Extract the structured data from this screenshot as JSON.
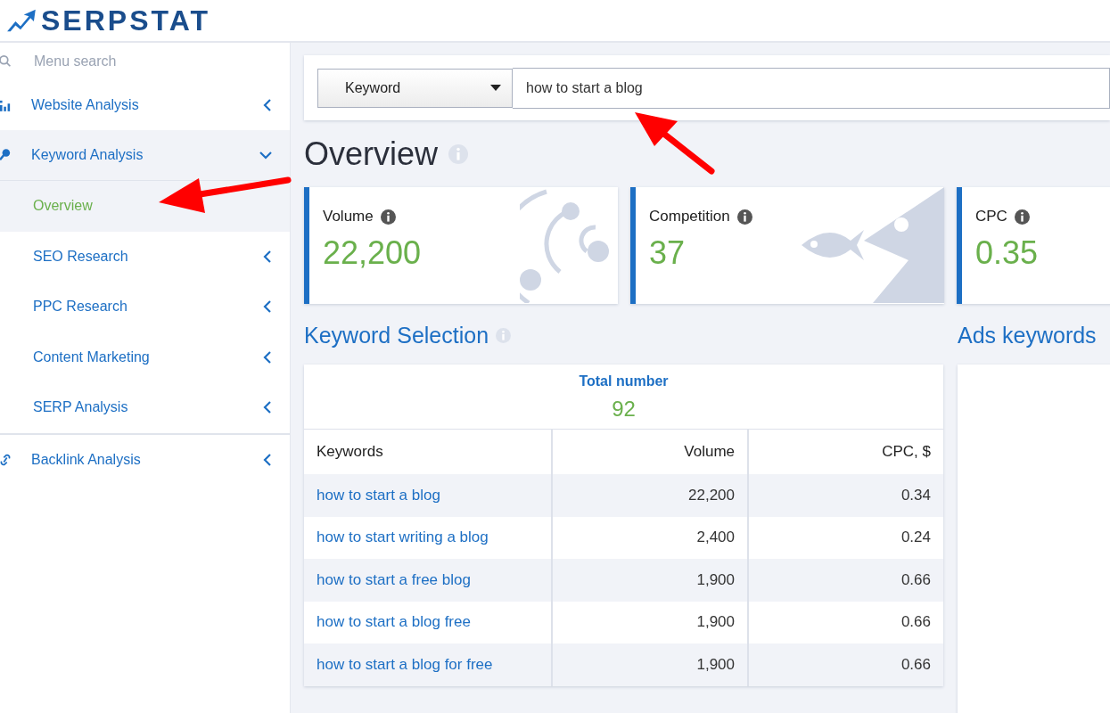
{
  "logo": {
    "text": "SERPSTAT"
  },
  "sidebar": {
    "search": {
      "placeholder": "Menu search"
    },
    "items": [
      {
        "label": "Website Analysis",
        "expanded": false
      },
      {
        "label": "Keyword Analysis",
        "expanded": true,
        "children": [
          {
            "label": "Overview",
            "selected": true,
            "has_children": false
          },
          {
            "label": "SEO Research",
            "selected": false,
            "has_children": true
          },
          {
            "label": "PPC Research",
            "selected": false,
            "has_children": true
          },
          {
            "label": "Content Marketing",
            "selected": false,
            "has_children": true
          },
          {
            "label": "SERP Analysis",
            "selected": false,
            "has_children": true
          }
        ]
      },
      {
        "label": "Backlink Analysis",
        "expanded": false
      }
    ]
  },
  "search_bar": {
    "type": "Keyword",
    "value": "how to start a blog"
  },
  "page_title": "Overview",
  "cards": [
    {
      "label": "Volume",
      "value": "22,200"
    },
    {
      "label": "Competition",
      "value": "37"
    },
    {
      "label": "CPC",
      "value": "0.35"
    }
  ],
  "keyword_selection": {
    "title": "Keyword Selection",
    "total_label": "Total number",
    "total": "92",
    "columns": [
      "Keywords",
      "Volume",
      "CPC, $"
    ],
    "rows": [
      {
        "keyword": "how to start a blog",
        "volume": "22,200",
        "cpc": "0.34"
      },
      {
        "keyword": "how to start writing a blog",
        "volume": "2,400",
        "cpc": "0.24"
      },
      {
        "keyword": "how to start a free blog",
        "volume": "1,900",
        "cpc": "0.66"
      },
      {
        "keyword": "how to start a blog free",
        "volume": "1,900",
        "cpc": "0.66"
      },
      {
        "keyword": "how to start a blog for free",
        "volume": "1,900",
        "cpc": "0.66"
      }
    ]
  },
  "ads_keywords": {
    "title": "Ads keywords"
  }
}
